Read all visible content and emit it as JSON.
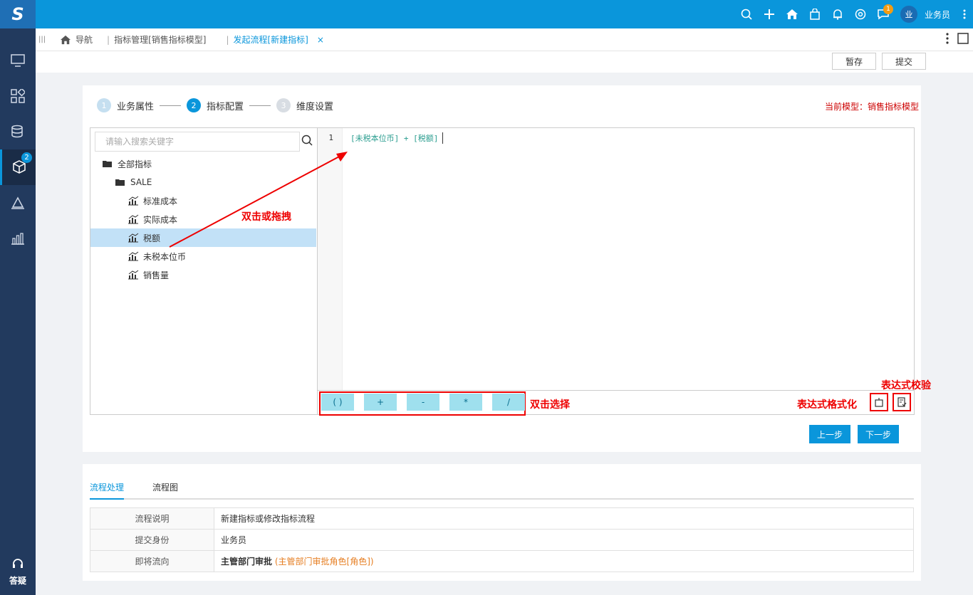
{
  "topbar": {
    "logo": "S",
    "icons": [
      "search-icon",
      "plus-icon",
      "home-icon",
      "bag-icon",
      "bell-icon",
      "settings-icon",
      "message-icon",
      "more-icon"
    ],
    "message_badge": "1",
    "avatar_text": "业",
    "username": "业务员"
  },
  "sidebar": {
    "items": [
      "monitor-icon",
      "apps-icon",
      "database-icon",
      "cube-icon",
      "layers-icon",
      "chart-icon"
    ],
    "active_badge": "2",
    "help_label": "答疑"
  },
  "tabs": {
    "nav": "导航",
    "items": [
      {
        "label": "指标管理[销售指标模型]"
      },
      {
        "label": "发起流程[新建指标]"
      }
    ],
    "close": "×"
  },
  "actions": {
    "save_draft": "暂存",
    "submit": "提交"
  },
  "steps": [
    {
      "num": "1",
      "label": "业务属性"
    },
    {
      "num": "2",
      "label": "指标配置"
    },
    {
      "num": "3",
      "label": "维度设置"
    }
  ],
  "current_model": "当前模型：销售指标模型",
  "tree": {
    "search_placeholder": "请输入搜索关键字",
    "root": "全部指标",
    "folder": "SALE",
    "items": [
      "标准成本",
      "实际成本",
      "税额",
      "未税本位币",
      "销售量"
    ]
  },
  "editor": {
    "line_number": "1",
    "code": "[未税本位币] + [税额]",
    "operators": [
      "( )",
      "+",
      "-",
      "*",
      "/"
    ]
  },
  "annotations": {
    "drag": "双击或拖拽",
    "select": "双击选择",
    "format": "表达式格式化",
    "validate": "表达式校验"
  },
  "nav_buttons": {
    "prev": "上一步",
    "next": "下一步"
  },
  "flow": {
    "tabs": [
      "流程处理",
      "流程图"
    ],
    "rows": [
      {
        "key": "流程说明",
        "value": "新建指标或修改指标流程"
      },
      {
        "key": "提交身份",
        "value": "业务员"
      },
      {
        "key": "即将流向",
        "value": "主管部门审批",
        "note": "(主管部门审批角色[角色])"
      }
    ]
  },
  "colors": {
    "primary": "#0a96db",
    "sidebar": "#223a5e",
    "annotation": "#e00000",
    "selected": "#c2e1f7"
  }
}
